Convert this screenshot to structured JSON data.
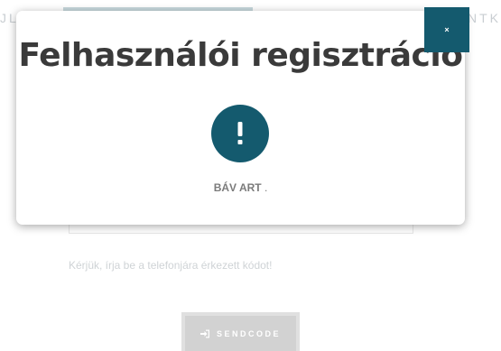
{
  "background": {
    "nav_left_text": "JL",
    "nav_right_text": "NTK",
    "hint_text": "Kérjük, írja be a telefonjára érkezett kódot!",
    "send_button_label": "SENDCODE",
    "send_icon": "sign-in-icon"
  },
  "modal": {
    "title": "Felhasználói regisztráció",
    "alert_icon": "exclamation-icon",
    "message_bold": "BÁV ART",
    "message_rest": " .",
    "close_label": "×"
  },
  "colors": {
    "accent": "#145a6e",
    "title_text": "#3a3a3a",
    "message_text": "#7b7b7b"
  }
}
